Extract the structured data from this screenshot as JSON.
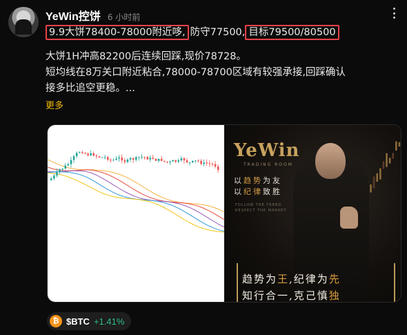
{
  "post": {
    "author": "YeWin控饼",
    "time": "6 小时前",
    "line1": {
      "highlight_entry": "9.9大饼78400-78000附近哆,",
      "stop": "防守77500,",
      "highlight_target": "目标79500/80500"
    },
    "paragraph_line1": "大饼1H冲高82200后连续回踩,现价78728。",
    "paragraph_line2": "短均线在8万关口附近粘合,78000-78700区域有较强承接,回踩确认",
    "paragraph_line3": "接多比追空更稳。...",
    "more_link": "更多"
  },
  "promo": {
    "brand": "YeWin",
    "brand_sub": "TRADING ROOM",
    "slogan1_pre": "以",
    "slogan1_gold": "趋势",
    "slogan1_post": "为友",
    "slogan2_pre": "以",
    "slogan2_gold": "纪律",
    "slogan2_post": "致胜",
    "follow_text_1": "FOLLOW THE TREND",
    "follow_text_2": "RESPECT THE MARKET",
    "motto1_pre": "趋势为",
    "motto1_gold": "王",
    "motto1_mid": ",纪律为",
    "motto1_gold2": "先",
    "motto2_pre": "知行合一,克己慎",
    "motto2_gold": "独"
  },
  "ticker": {
    "symbol": "$BTC",
    "change": "+1.41%",
    "icon": "bitcoin-icon"
  },
  "colors": {
    "highlight_border": "#e8424a",
    "link": "#f0b90b",
    "positive": "#2ebd85",
    "bullish_candle": "#26a69a",
    "bearish_candle": "#ef5350"
  }
}
